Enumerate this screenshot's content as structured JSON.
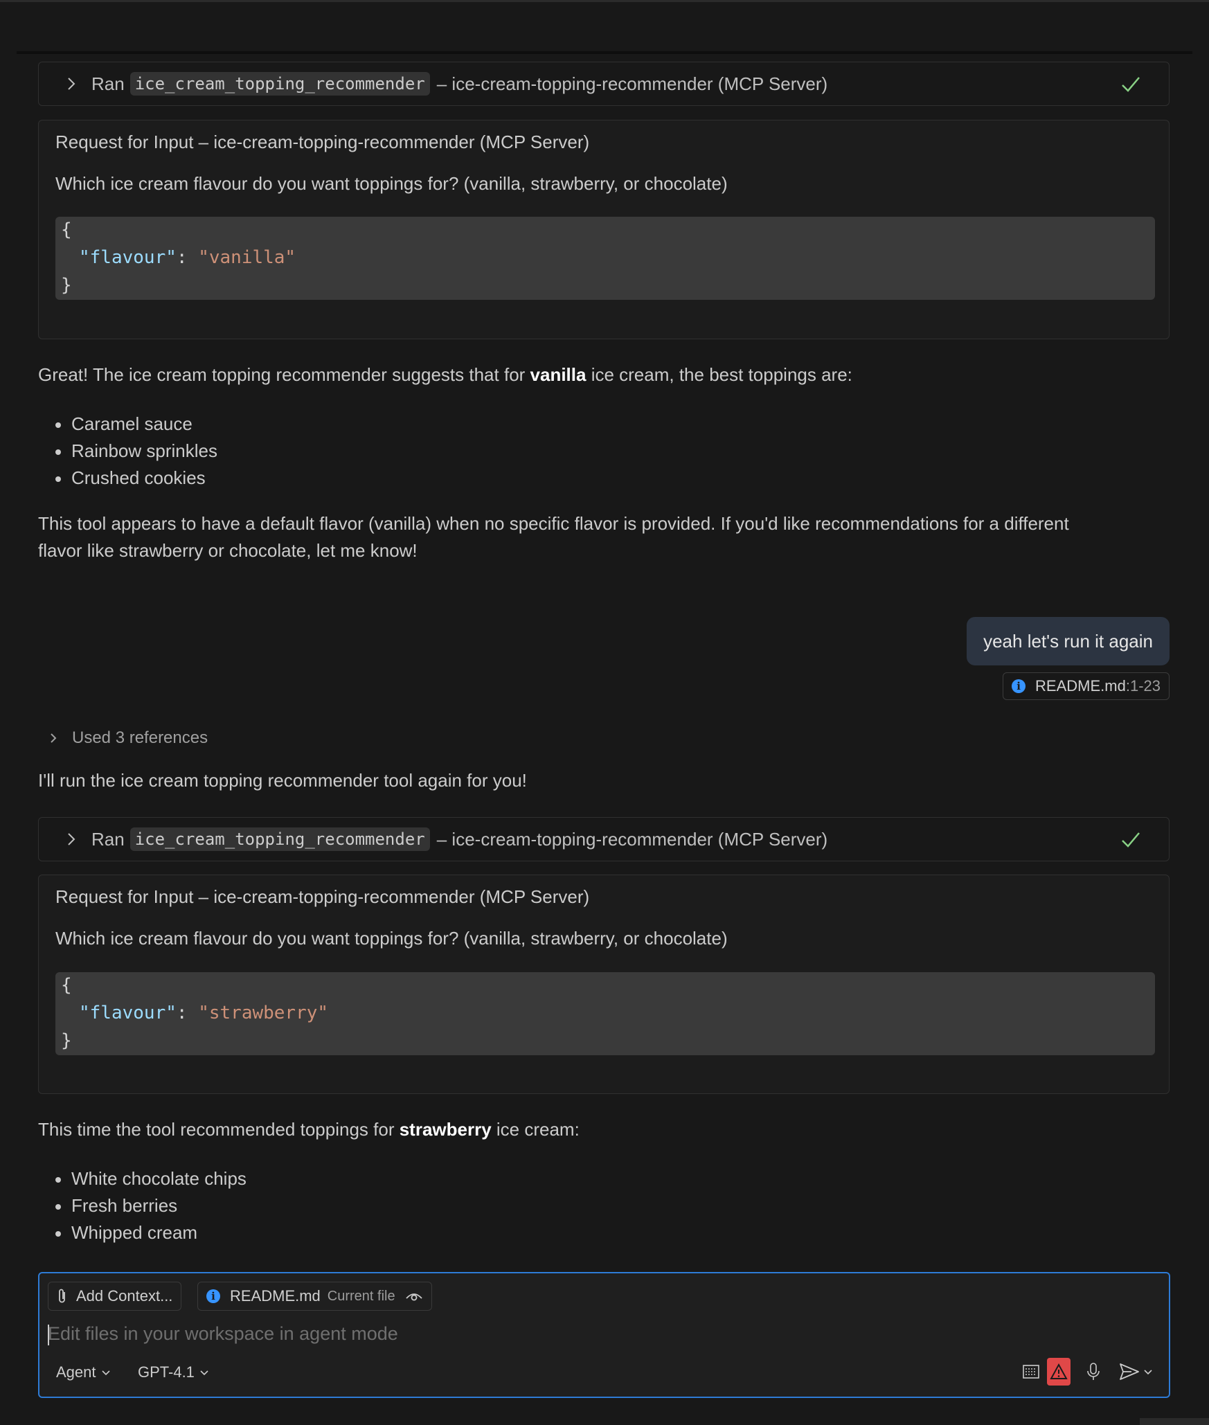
{
  "tool_calls": [
    {
      "ran": "Ran",
      "tool_name": "ice_cream_topping_recommender",
      "server": "– ice-cream-topping-recommender (MCP Server)"
    },
    {
      "ran": "Ran",
      "tool_name": "ice_cream_topping_recommender",
      "server": "– ice-cream-topping-recommender (MCP Server)"
    }
  ],
  "requests": [
    {
      "title": "Request for Input – ice-cream-topping-recommender (MCP Server)",
      "question": "Which ice cream flavour do you want toppings for? (vanilla, strawberry, or chocolate)",
      "open": "{",
      "key": "\"flavour\"",
      "colon": ": ",
      "value": "\"vanilla\"",
      "close": "}"
    },
    {
      "title": "Request for Input – ice-cream-topping-recommender (MCP Server)",
      "question": "Which ice cream flavour do you want toppings for? (vanilla, strawberry, or chocolate)",
      "open": "{",
      "key": "\"flavour\"",
      "colon": ": ",
      "value": "\"strawberry\"",
      "close": "}"
    }
  ],
  "response1": {
    "intro_a": "Great! The ice cream topping recommender suggests that for ",
    "intro_b": "vanilla",
    "intro_c": " ice cream, the best toppings are:",
    "items": [
      "Caramel sauce",
      "Rainbow sprinkles",
      "Crushed cookies"
    ],
    "outro_1": "This tool appears to have a default flavor (vanilla) when no specific flavor is provided. If you'd like recommendations for a different",
    "outro_2": "flavor like strawberry or chocolate, let me know!"
  },
  "user_message": {
    "text": "yeah let's run it again",
    "ref_file": "README.md",
    "ref_range": ":1-23"
  },
  "used_references": "Used 3 references",
  "response2": {
    "intro": "I'll run the ice cream topping recommender tool again for you!",
    "summary_a": "This time the tool recommended toppings for ",
    "summary_b": "strawberry",
    "summary_c": " ice cream:",
    "items": [
      "White chocolate chips",
      "Fresh berries",
      "Whipped cream"
    ]
  },
  "input": {
    "add_context": "Add Context...",
    "file_chip": "README.md",
    "file_chip_sub": "Current file",
    "placeholder": "Edit files in your workspace in agent mode",
    "mode": "Agent",
    "model": "GPT-4.1"
  },
  "icons": {
    "check_color": "#89d185",
    "info_color": "#3794ff",
    "warning_bg": "#e04848"
  }
}
